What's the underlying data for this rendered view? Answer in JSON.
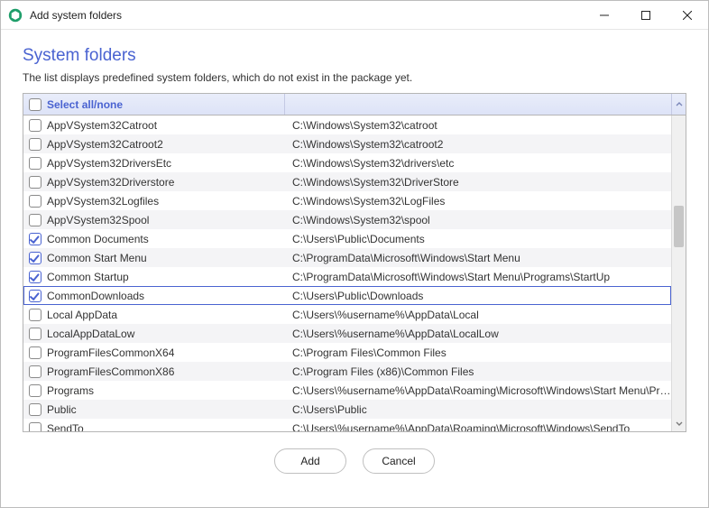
{
  "window": {
    "title": "Add system folders"
  },
  "page": {
    "heading": "System folders",
    "subtitle": "The list displays predefined system folders, which do not exist in the package yet."
  },
  "table": {
    "header_label": "Select all/none",
    "rows": [
      {
        "name": "AppVSystem32Catroot",
        "path": "C:\\Windows\\System32\\catroot",
        "checked": false,
        "selected": false
      },
      {
        "name": "AppVSystem32Catroot2",
        "path": "C:\\Windows\\System32\\catroot2",
        "checked": false,
        "selected": false
      },
      {
        "name": "AppVSystem32DriversEtc",
        "path": "C:\\Windows\\System32\\drivers\\etc",
        "checked": false,
        "selected": false
      },
      {
        "name": "AppVSystem32Driverstore",
        "path": "C:\\Windows\\System32\\DriverStore",
        "checked": false,
        "selected": false
      },
      {
        "name": "AppVSystem32Logfiles",
        "path": "C:\\Windows\\System32\\LogFiles",
        "checked": false,
        "selected": false
      },
      {
        "name": "AppVSystem32Spool",
        "path": "C:\\Windows\\System32\\spool",
        "checked": false,
        "selected": false
      },
      {
        "name": "Common Documents",
        "path": "C:\\Users\\Public\\Documents",
        "checked": true,
        "selected": false
      },
      {
        "name": "Common Start Menu",
        "path": "C:\\ProgramData\\Microsoft\\Windows\\Start Menu",
        "checked": true,
        "selected": false
      },
      {
        "name": "Common Startup",
        "path": "C:\\ProgramData\\Microsoft\\Windows\\Start Menu\\Programs\\StartUp",
        "checked": true,
        "selected": false
      },
      {
        "name": "CommonDownloads",
        "path": "C:\\Users\\Public\\Downloads",
        "checked": true,
        "selected": true
      },
      {
        "name": "Local AppData",
        "path": "C:\\Users\\%username%\\AppData\\Local",
        "checked": false,
        "selected": false
      },
      {
        "name": "LocalAppDataLow",
        "path": "C:\\Users\\%username%\\AppData\\LocalLow",
        "checked": false,
        "selected": false
      },
      {
        "name": "ProgramFilesCommonX64",
        "path": "C:\\Program Files\\Common Files",
        "checked": false,
        "selected": false
      },
      {
        "name": "ProgramFilesCommonX86",
        "path": "C:\\Program Files (x86)\\Common Files",
        "checked": false,
        "selected": false
      },
      {
        "name": "Programs",
        "path": "C:\\Users\\%username%\\AppData\\Roaming\\Microsoft\\Windows\\Start Menu\\Programs",
        "checked": false,
        "selected": false
      },
      {
        "name": "Public",
        "path": "C:\\Users\\Public",
        "checked": false,
        "selected": false
      },
      {
        "name": "SendTo",
        "path": "C:\\Users\\%username%\\AppData\\Roaming\\Microsoft\\Windows\\SendTo",
        "checked": false,
        "selected": false
      }
    ]
  },
  "footer": {
    "add_label": "Add",
    "cancel_label": "Cancel"
  }
}
